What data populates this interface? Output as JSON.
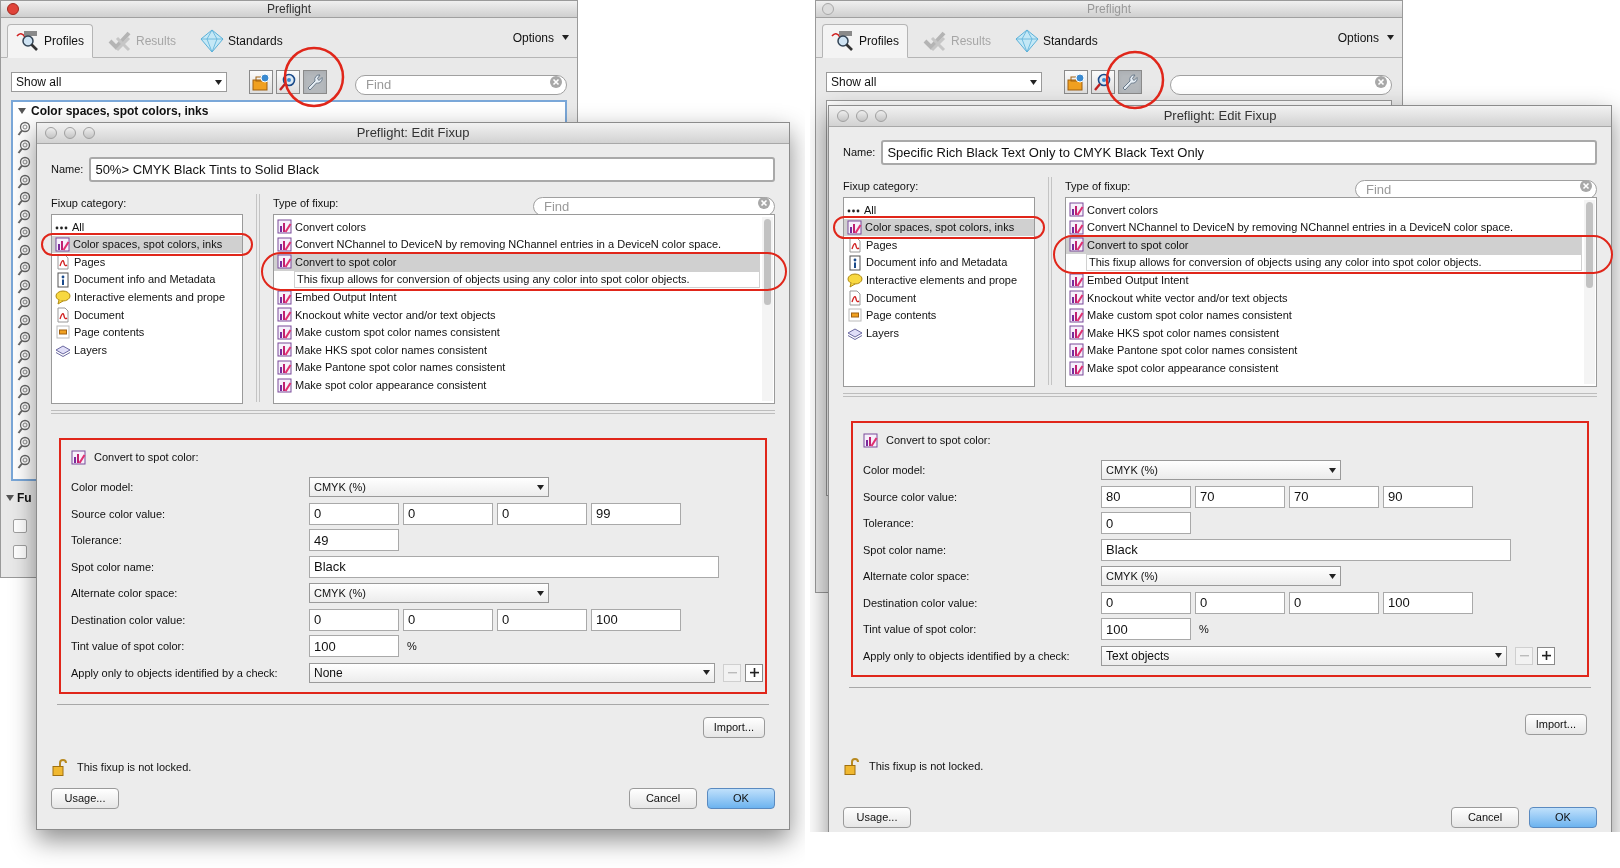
{
  "screens": [
    {
      "preflight_window": {
        "title": "Preflight",
        "active": true,
        "tabs": [
          {
            "label": "Profiles",
            "kind": "profiles",
            "selected": true,
            "disabled": false
          },
          {
            "label": "Results",
            "kind": "results",
            "selected": false,
            "disabled": true
          },
          {
            "label": "Standards",
            "kind": "standards",
            "selected": false,
            "disabled": false
          }
        ],
        "options_label": "Options",
        "filter": "Show all",
        "toolbar_buttons": [
          {
            "kind": "profile",
            "selected": false
          },
          {
            "kind": "check",
            "selected": false
          },
          {
            "kind": "fixup",
            "selected": true
          }
        ],
        "find_placeholder": "Find",
        "tree_focused": true,
        "tree_heading": "Color spaces, spot colors, inks",
        "lower_heading": "Fu",
        "lower_checkboxes": [
          {
            "checked": false
          },
          {
            "checked": false
          }
        ]
      },
      "edit_dialog": {
        "title": "Preflight: Edit Fixup",
        "name_label": "Name:",
        "name_value": "50%> CMYK Black Tints to Solid Black",
        "category_label": "Fixup category:",
        "categories": [
          {
            "label": "All",
            "kind": "all",
            "selected": false
          },
          {
            "label": "Color spaces, spot colors, inks",
            "kind": "colors",
            "selected": true
          },
          {
            "label": "Pages",
            "kind": "pages",
            "selected": false
          },
          {
            "label": "Document info and Metadata",
            "kind": "info",
            "selected": false
          },
          {
            "label": "Interactive elements and prope",
            "kind": "interactive",
            "selected": false
          },
          {
            "label": "Document",
            "kind": "document",
            "selected": false
          },
          {
            "label": "Page contents",
            "kind": "contents",
            "selected": false
          },
          {
            "label": "Layers",
            "kind": "layers",
            "selected": false
          }
        ],
        "type_label": "Type of fixup:",
        "type_find_placeholder": "Find",
        "types": [
          {
            "label": "Convert colors",
            "selected": false
          },
          {
            "label": "Convert NChannel to DeviceN by removing NChannel entries in a DeviceN color space.",
            "selected": false
          },
          {
            "label": "Convert to spot color",
            "selected": true,
            "description": "This fixup allows for conversion of objects using any color into spot color objects."
          },
          {
            "label": "Embed Output Intent",
            "selected": false
          },
          {
            "label": "Knockout white vector and/or text objects",
            "selected": false
          },
          {
            "label": "Make custom spot color names consistent",
            "selected": false
          },
          {
            "label": "Make HKS spot color names consistent",
            "selected": false
          },
          {
            "label": "Make Pantone spot color names consistent",
            "selected": false
          },
          {
            "label": "Make spot color appearance consistent",
            "selected": false
          }
        ],
        "settings_heading": "Convert to spot color:",
        "settings": [
          {
            "kind": "select",
            "label": "Color model:",
            "value": "CMYK (%)"
          },
          {
            "kind": "quad",
            "label": "Source color value:",
            "values": [
              "0",
              "0",
              "0",
              "99"
            ]
          },
          {
            "kind": "short",
            "label": "Tolerance:",
            "value": "49"
          },
          {
            "kind": "wide",
            "label": "Spot color name:",
            "value": "Black"
          },
          {
            "kind": "select",
            "label": "Alternate color space:",
            "value": "CMYK (%)"
          },
          {
            "kind": "quad",
            "label": "Destination color value:",
            "values": [
              "0",
              "0",
              "0",
              "100"
            ]
          },
          {
            "kind": "percent",
            "label": "Tint value of spot color:",
            "value": "100",
            "unit": "%"
          },
          {
            "kind": "check",
            "label": "Apply only to objects identified by a check:",
            "value": "None"
          }
        ],
        "import_button": "Import...",
        "lock_text": "This fixup is not locked.",
        "buttons": [
          {
            "label": "Usage...",
            "default": false
          },
          {
            "label": "Cancel",
            "default": false
          },
          {
            "label": "OK",
            "default": true
          }
        ]
      }
    },
    {
      "preflight_window": {
        "title": "Preflight",
        "active": false,
        "tabs": [
          {
            "label": "Profiles",
            "kind": "profiles",
            "selected": true,
            "disabled": false
          },
          {
            "label": "Results",
            "kind": "results",
            "selected": false,
            "disabled": true
          },
          {
            "label": "Standards",
            "kind": "standards",
            "selected": false,
            "disabled": false
          }
        ],
        "options_label": "Options",
        "filter": "Show all",
        "toolbar_buttons": [
          {
            "kind": "profile",
            "selected": false
          },
          {
            "kind": "check",
            "selected": false
          },
          {
            "kind": "fixup",
            "selected": true
          }
        ],
        "tree_focused": false
      },
      "edit_dialog": {
        "title": "Preflight: Edit Fixup",
        "name_label": "Name:",
        "name_value": "Specific Rich Black Text Only to CMYK Black Text Only",
        "category_label": "Fixup category:",
        "categories": [
          {
            "label": "All",
            "kind": "all",
            "selected": false
          },
          {
            "label": "Color spaces, spot colors, inks",
            "kind": "colors",
            "selected": true
          },
          {
            "label": "Pages",
            "kind": "pages",
            "selected": false
          },
          {
            "label": "Document info and Metadata",
            "kind": "info",
            "selected": false
          },
          {
            "label": "Interactive elements and prope",
            "kind": "interactive",
            "selected": false
          },
          {
            "label": "Document",
            "kind": "document",
            "selected": false
          },
          {
            "label": "Page contents",
            "kind": "contents",
            "selected": false
          },
          {
            "label": "Layers",
            "kind": "layers",
            "selected": false
          }
        ],
        "type_label": "Type of fixup:",
        "type_find_placeholder": "Find",
        "types": [
          {
            "label": "Convert colors",
            "selected": false
          },
          {
            "label": "Convert NChannel to DeviceN by removing NChannel entries in a DeviceN color space.",
            "selected": false
          },
          {
            "label": "Convert to spot color",
            "selected": true,
            "description": "This fixup allows for conversion of objects using any color into spot color objects."
          },
          {
            "label": "Embed Output Intent",
            "selected": false
          },
          {
            "label": "Knockout white vector and/or text objects",
            "selected": false
          },
          {
            "label": "Make custom spot color names consistent",
            "selected": false
          },
          {
            "label": "Make HKS spot color names consistent",
            "selected": false
          },
          {
            "label": "Make Pantone spot color names consistent",
            "selected": false
          },
          {
            "label": "Make spot color appearance consistent",
            "selected": false
          }
        ],
        "settings_heading": "Convert to spot color:",
        "settings": [
          {
            "kind": "select",
            "label": "Color model:",
            "value": "CMYK (%)"
          },
          {
            "kind": "quad",
            "label": "Source color value:",
            "values": [
              "80",
              "70",
              "70",
              "90"
            ]
          },
          {
            "kind": "short",
            "label": "Tolerance:",
            "value": "0"
          },
          {
            "kind": "wide",
            "label": "Spot color name:",
            "value": "Black"
          },
          {
            "kind": "select",
            "label": "Alternate color space:",
            "value": "CMYK (%)"
          },
          {
            "kind": "quad",
            "label": "Destination color value:",
            "values": [
              "0",
              "0",
              "0",
              "100"
            ]
          },
          {
            "kind": "percent",
            "label": "Tint value of spot color:",
            "value": "100",
            "unit": "%"
          },
          {
            "kind": "check",
            "label": "Apply only to objects identified by a check:",
            "value": "Text objects"
          }
        ],
        "import_button": "Import...",
        "lock_text": "This fixup is not locked.",
        "buttons": [
          {
            "label": "Usage...",
            "default": false
          },
          {
            "label": "Cancel",
            "default": false
          },
          {
            "label": "OK",
            "default": true
          }
        ]
      }
    }
  ]
}
